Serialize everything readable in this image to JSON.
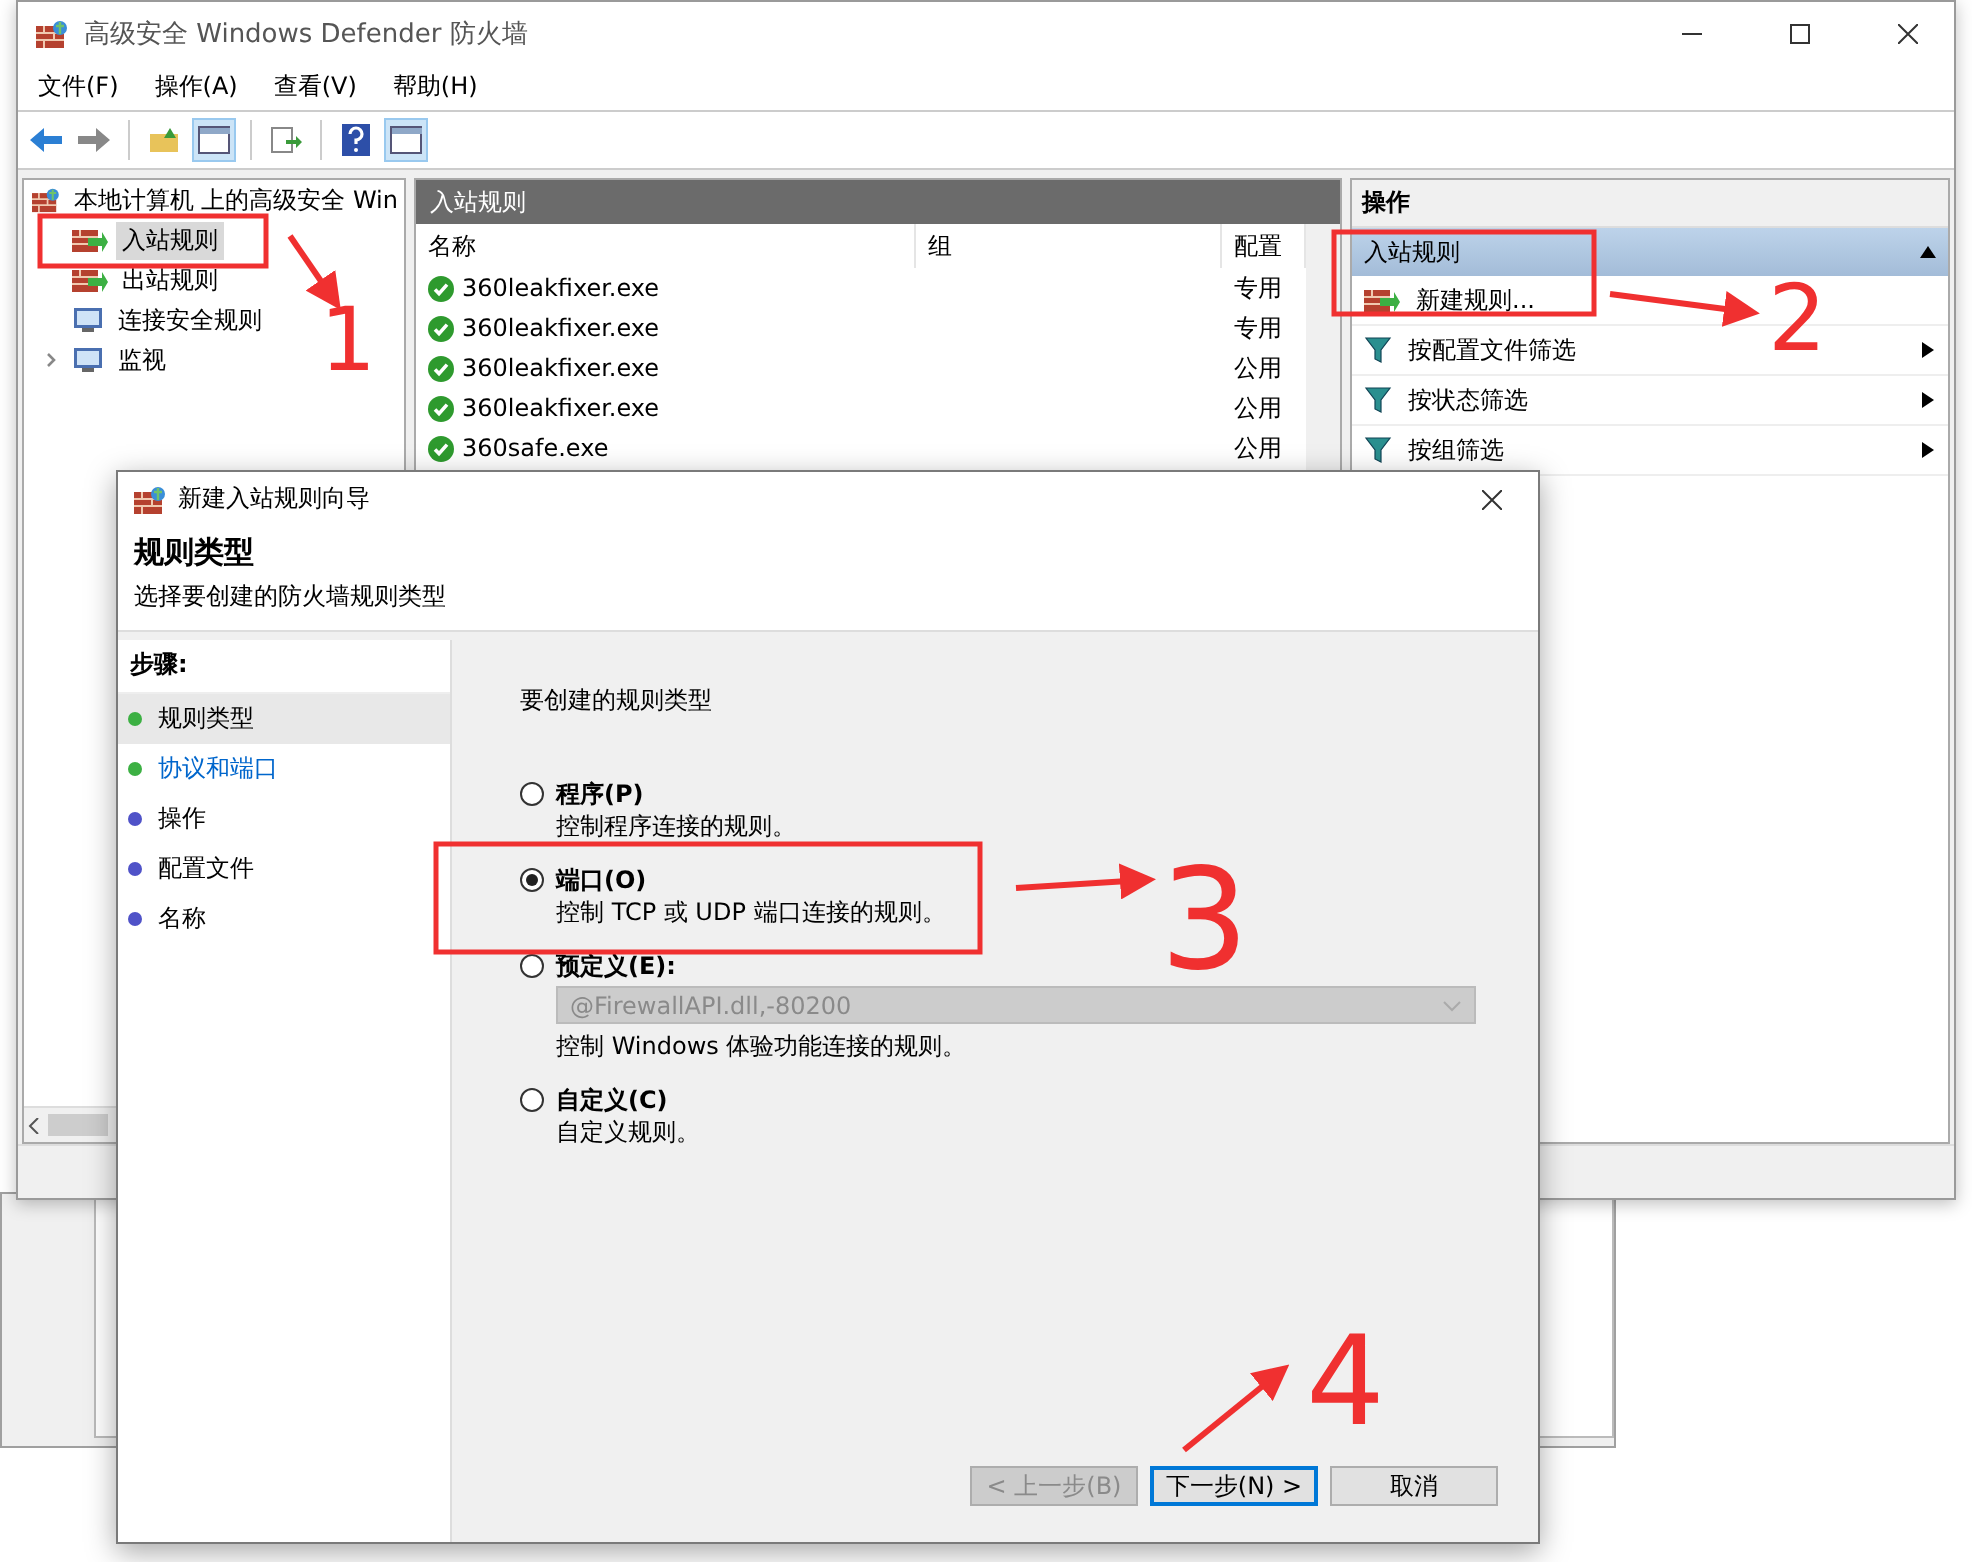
{
  "main_window": {
    "title": "高级安全 Windows Defender 防火墙",
    "menu": [
      "文件(F)",
      "操作(A)",
      "查看(V)",
      "帮助(H)"
    ],
    "tree": {
      "label": "本地计算机 上的高级安全 Win",
      "children": [
        {
          "label": "入站规则",
          "selected": true,
          "kind": "inbound"
        },
        {
          "label": "出站规则",
          "selected": false,
          "kind": "outbound"
        },
        {
          "label": "连接安全规则",
          "selected": false,
          "kind": "security"
        },
        {
          "label": "监视",
          "selected": false,
          "kind": "monitor",
          "expanded": false
        }
      ]
    },
    "rules": {
      "title": "入站规则",
      "columns": [
        "名称",
        "组",
        "配置"
      ],
      "rows": [
        {
          "name": "360leakfixer.exe",
          "profile": "专用"
        },
        {
          "name": "360leakfixer.exe",
          "profile": "专用"
        },
        {
          "name": "360leakfixer.exe",
          "profile": "公用"
        },
        {
          "name": "360leakfixer.exe",
          "profile": "公用"
        },
        {
          "name": "360safe.exe",
          "profile": "公用"
        }
      ]
    },
    "actions": {
      "title": "操作",
      "section": {
        "label": "入站规则",
        "expanded": true
      },
      "items": [
        {
          "label": "新建规则...",
          "kind": "new"
        },
        {
          "label": "按配置文件筛选",
          "kind": "filter"
        },
        {
          "label": "按状态筛选",
          "kind": "filter"
        },
        {
          "label": "按组筛选",
          "kind": "filter"
        }
      ]
    }
  },
  "dialog": {
    "title": "新建入站规则向导",
    "heading": "规则类型",
    "subheading": "选择要创建的防火墙规则类型",
    "steps_title": "步骤:",
    "steps": [
      {
        "label": "规则类型",
        "selected": true,
        "link": false,
        "color": "#3cb043"
      },
      {
        "label": "协议和端口",
        "selected": false,
        "link": true,
        "color": "#3cb043"
      },
      {
        "label": "操作",
        "selected": false,
        "link": false,
        "color": "#4f52c8"
      },
      {
        "label": "配置文件",
        "selected": false,
        "link": false,
        "color": "#4f52c8"
      },
      {
        "label": "名称",
        "selected": false,
        "link": false,
        "color": "#4f52c8"
      }
    ],
    "prompt": "要创建的规则类型",
    "options": [
      {
        "label": "程序(P)",
        "description": "控制程序连接的规则。",
        "selected": false
      },
      {
        "label": "端口(O)",
        "description": "控制 TCP 或 UDP 端口连接的规则。",
        "selected": true
      },
      {
        "label": "预定义(E):",
        "description": "控制 Windows 体验功能连接的规则。",
        "selected": false,
        "dropdown": {
          "value": "@FirewallAPI.dll,-80200",
          "disabled": true
        }
      },
      {
        "label": "自定义(C)",
        "description": "自定义规则。",
        "selected": false
      }
    ],
    "buttons": [
      {
        "label": "< 上一步(B)",
        "disabled": true,
        "default": false
      },
      {
        "label": "下一步(N) >",
        "disabled": false,
        "default": true
      },
      {
        "label": "取消",
        "disabled": false,
        "default": false
      }
    ]
  },
  "annotations": [
    {
      "label": "1"
    },
    {
      "label": "2"
    },
    {
      "label": "3"
    },
    {
      "label": "4"
    }
  ]
}
